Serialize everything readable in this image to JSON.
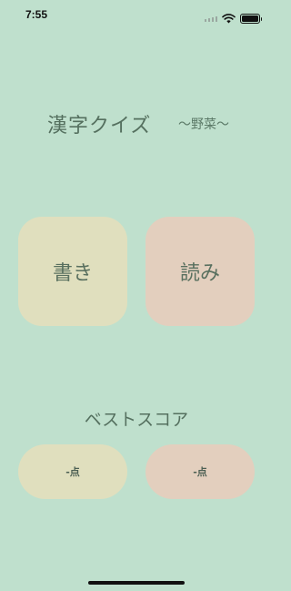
{
  "status_bar": {
    "time": "7:55",
    "icons": [
      "signal-icon",
      "wifi-icon",
      "battery-icon"
    ]
  },
  "header": {
    "title": "漢字クイズ",
    "subtitle": "〜野菜〜"
  },
  "modes": {
    "write_label": "書き",
    "read_label": "読み"
  },
  "best_score": {
    "label": "ベストスコア",
    "write_score": "-点",
    "read_score": "-点"
  },
  "colors": {
    "background": "#bfe0cd",
    "write_accent": "#e0dfbe",
    "read_accent": "#e3cfbe",
    "text": "#55705f"
  }
}
